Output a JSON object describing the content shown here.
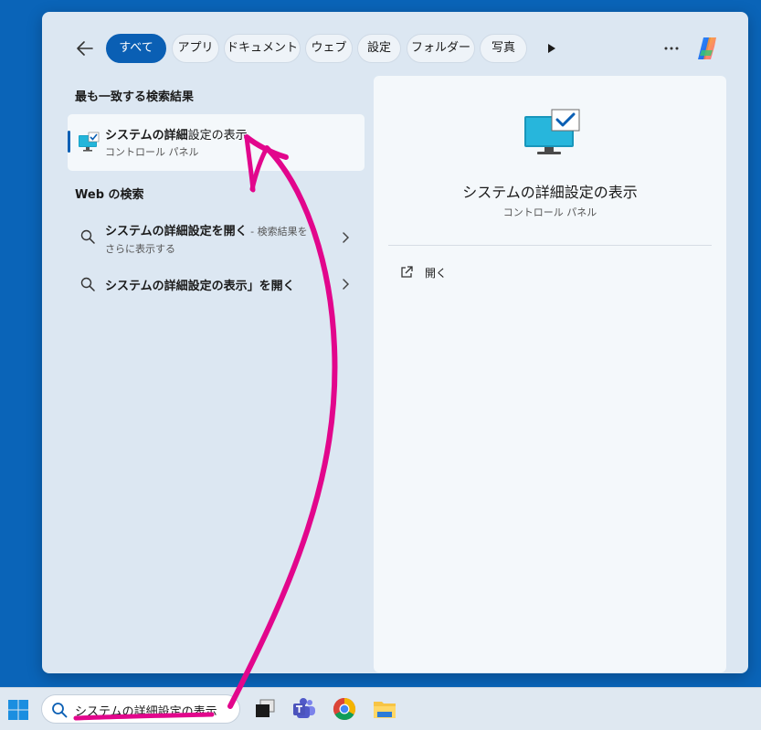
{
  "filters": {
    "back_label": "",
    "chips": [
      {
        "label": "すべて",
        "active": true
      },
      {
        "label": "アプリ",
        "active": false
      },
      {
        "label": "ドキュメント",
        "active": false
      },
      {
        "label": "ウェブ",
        "active": false
      },
      {
        "label": "設定",
        "active": false
      },
      {
        "label": "フォルダー",
        "active": false
      },
      {
        "label": "写真",
        "active": false
      }
    ]
  },
  "best_match": {
    "heading": "最も一致する検索結果",
    "title_bold": "システムの詳細",
    "title_rest": "設定の表示",
    "subtitle": "コントロール パネル",
    "icon": "monitor-check-icon"
  },
  "web_search": {
    "heading": "Web の検索",
    "items": [
      {
        "text_bold": "システムの詳細設定を開く",
        "text_suffix": " - 検索結果を",
        "text_line2": "さらに表示する"
      },
      {
        "text_bold": "システムの詳細設定の表示」を開く",
        "text_suffix": "",
        "text_line2": ""
      }
    ]
  },
  "preview": {
    "title": "システムの詳細設定の表示",
    "subtitle": "コントロール パネル",
    "actions": [
      {
        "label": "開く",
        "icon": "open-external-icon"
      }
    ]
  },
  "taskbar": {
    "search_text": "システムの詳細設定の表示",
    "apps": [
      "task-view-icon",
      "teams-icon",
      "chrome-icon",
      "file-explorer-icon"
    ]
  },
  "colors": {
    "accent": "#0a5fb4",
    "annotation": "#e2068c",
    "desktop": "#0a64b8"
  }
}
